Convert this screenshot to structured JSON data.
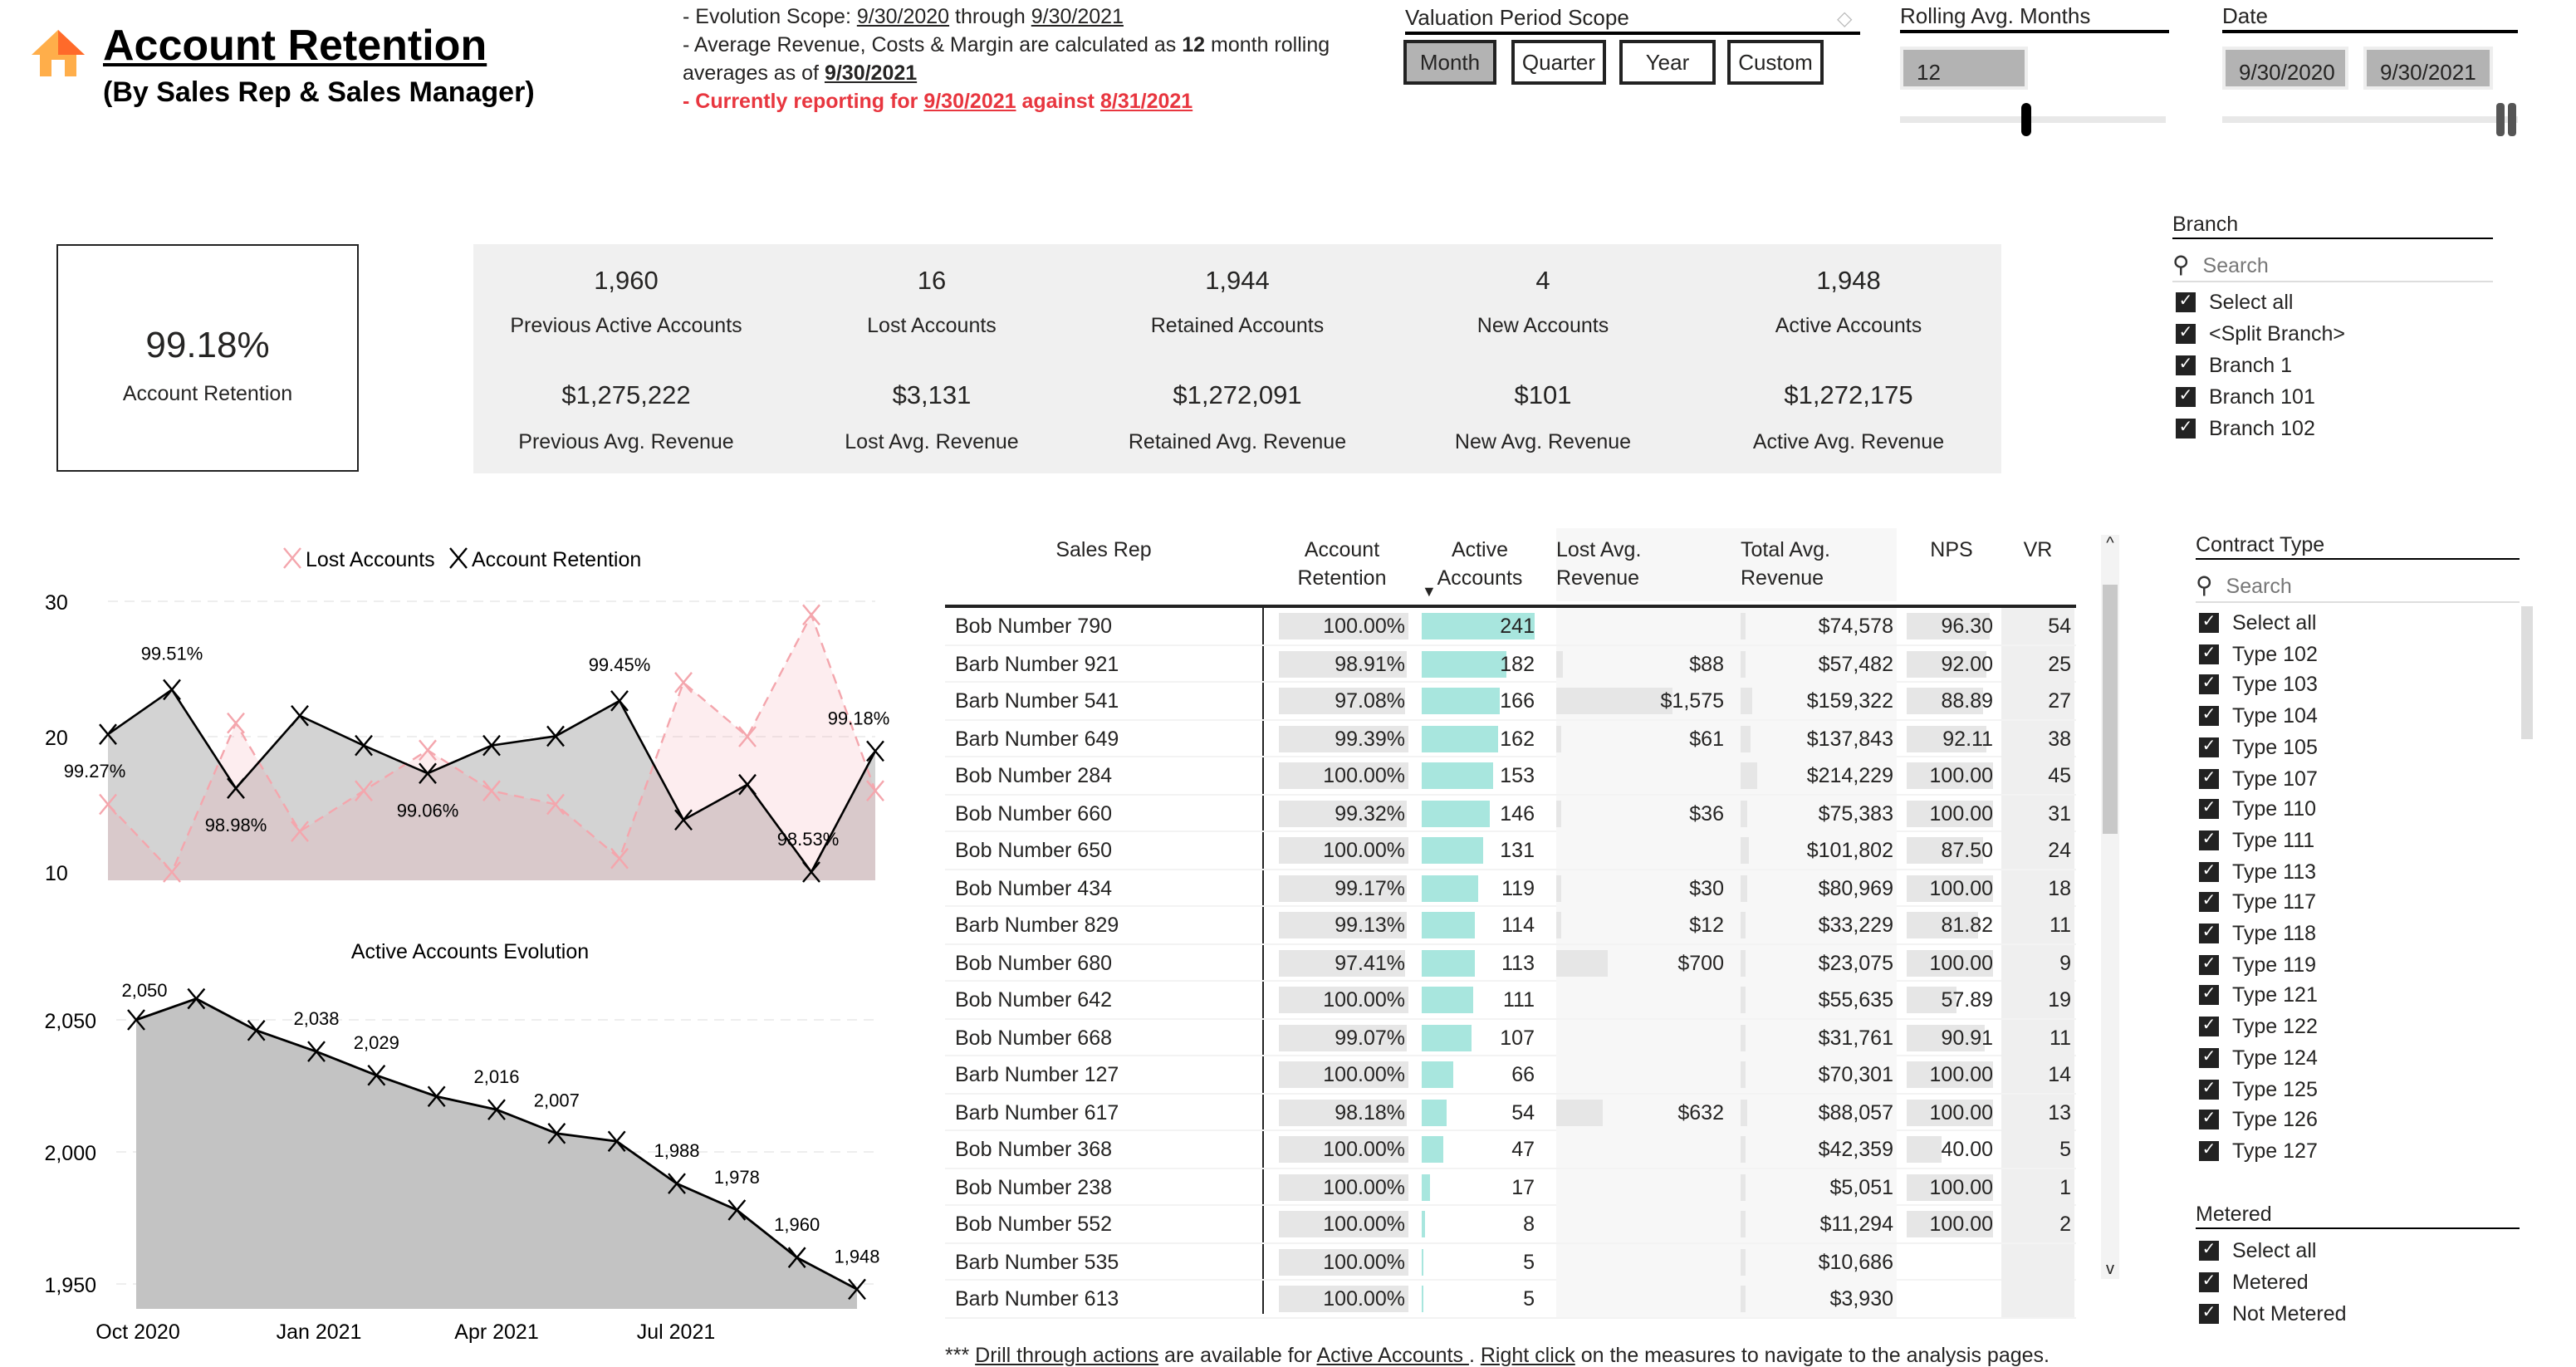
{
  "header": {
    "title": "Account Retention",
    "subtitle": "(By Sales Rep & Sales Manager)",
    "icon": "home-icon"
  },
  "notes": {
    "l1_pre": "- Evolution Scope: ",
    "l1_d1": "9/30/2020",
    "l1_mid": " through ",
    "l1_d2": "9/30/2021",
    "l2_pre": "- Average Revenue, Costs & Margin are calculated as ",
    "l2_num": "12",
    "l2_post": " month rolling averages as of ",
    "l2_date": "9/30/2021",
    "l3_pre": "- Currently reporting for ",
    "l3_d1": "9/30/2021",
    "l3_mid": " against ",
    "l3_d2": "8/31/2021"
  },
  "period": {
    "title": "Valuation Period Scope",
    "options": [
      "Month",
      "Quarter",
      "Year",
      "Custom"
    ],
    "selected": "Month",
    "eraser_icon": "eraser-icon"
  },
  "rolling": {
    "title": "Rolling Avg. Months",
    "value": "12",
    "slider_fraction": 0.5
  },
  "date": {
    "title": "Date",
    "from": "9/30/2020",
    "to": "9/30/2021",
    "slider_fraction": 1.0
  },
  "kpi_main": {
    "value": "99.18%",
    "label": "Account Retention"
  },
  "kpis": [
    {
      "v1": "1,960",
      "l1": "Previous Active Accounts",
      "v2": "$1,275,222",
      "l2": "Previous Avg. Revenue"
    },
    {
      "v1": "16",
      "l1": "Lost Accounts",
      "v2": "$3,131",
      "l2": "Lost Avg. Revenue"
    },
    {
      "v1": "1,944",
      "l1": "Retained Accounts",
      "v2": "$1,272,091",
      "l2": "Retained Avg. Revenue"
    },
    {
      "v1": "4",
      "l1": "New Accounts",
      "v2": "$101",
      "l2": "New Avg. Revenue"
    },
    {
      "v1": "1,948",
      "l1": "Active Accounts",
      "v2": "$1,272,175",
      "l2": "Active Avg. Revenue"
    }
  ],
  "branch": {
    "title": "Branch",
    "search": "Search",
    "items": [
      "Select all",
      "<Split Branch>",
      "Branch 1",
      "Branch 101",
      "Branch 102"
    ]
  },
  "contract": {
    "title": "Contract Type",
    "search": "Search",
    "items": [
      "Select all",
      "Type 102",
      "Type 103",
      "Type 104",
      "Type 105",
      "Type 107",
      "Type 110",
      "Type 111",
      "Type 113",
      "Type 117",
      "Type 118",
      "Type 119",
      "Type 121",
      "Type 122",
      "Type 124",
      "Type 125",
      "Type 126",
      "Type 127"
    ]
  },
  "metered": {
    "title": "Metered",
    "items": [
      "Select all",
      "Metered",
      "Not Metered"
    ]
  },
  "table": {
    "headers": [
      "Sales Rep",
      "Account\nRetention",
      "Active\nAccounts",
      "Lost Avg.\nRevenue",
      "Total Avg.\nRevenue",
      "NPS",
      "VR"
    ],
    "sort_column": "Active Accounts",
    "sort_dir": "desc",
    "bar_color": "#a8e6de",
    "rows": [
      [
        "Bob Number 790",
        "100.00%",
        "241",
        "",
        "$74,578",
        "96.30",
        "54"
      ],
      [
        "Barb Number 921",
        "98.91%",
        "182",
        "$88",
        "$57,482",
        "92.00",
        "25"
      ],
      [
        "Barb Number 541",
        "97.08%",
        "166",
        "$1,575",
        "$159,322",
        "88.89",
        "27"
      ],
      [
        "Barb Number 649",
        "99.39%",
        "162",
        "$61",
        "$137,843",
        "92.11",
        "38"
      ],
      [
        "Bob Number 284",
        "100.00%",
        "153",
        "",
        "$214,229",
        "100.00",
        "45"
      ],
      [
        "Bob Number 660",
        "99.32%",
        "146",
        "$36",
        "$75,383",
        "100.00",
        "31"
      ],
      [
        "Bob Number 650",
        "100.00%",
        "131",
        "",
        "$101,802",
        "87.50",
        "24"
      ],
      [
        "Bob Number 434",
        "99.17%",
        "119",
        "$30",
        "$80,969",
        "100.00",
        "18"
      ],
      [
        "Barb Number 829",
        "99.13%",
        "114",
        "$12",
        "$33,229",
        "81.82",
        "11"
      ],
      [
        "Bob Number 680",
        "97.41%",
        "113",
        "$700",
        "$23,075",
        "100.00",
        "9"
      ],
      [
        "Bob Number 642",
        "100.00%",
        "111",
        "",
        "$55,635",
        "57.89",
        "19"
      ],
      [
        "Bob Number 668",
        "99.07%",
        "107",
        "",
        "$31,761",
        "90.91",
        "11"
      ],
      [
        "Barb Number 127",
        "100.00%",
        "66",
        "",
        "$70,301",
        "100.00",
        "14"
      ],
      [
        "Barb Number 617",
        "98.18%",
        "54",
        "$632",
        "$88,057",
        "100.00",
        "13"
      ],
      [
        "Bob Number 368",
        "100.00%",
        "47",
        "",
        "$42,359",
        "40.00",
        "5"
      ],
      [
        "Bob Number 238",
        "100.00%",
        "17",
        "",
        "$5,051",
        "100.00",
        "1"
      ],
      [
        "Bob Number 552",
        "100.00%",
        "8",
        "",
        "$11,294",
        "100.00",
        "2"
      ],
      [
        "Barb Number 535",
        "100.00%",
        "5",
        "",
        "$10,686",
        "",
        ""
      ],
      [
        "Barb Number 613",
        "100.00%",
        "5",
        "",
        "$3,930",
        "",
        ""
      ]
    ]
  },
  "footer": {
    "pre": "*** ",
    "l1": "Drill through actions",
    "m1": " are available for ",
    "l2": "Active Accounts ",
    "m2": ". ",
    "l3": "Right click",
    "post": " on the measures to navigate to the analysis pages."
  },
  "chart_data": [
    {
      "type": "line",
      "legend_position": "top-center",
      "grid": true,
      "yticks": [
        "30",
        "20",
        "10"
      ],
      "ylim": [
        10,
        30
      ],
      "y2lim": [
        98.53,
        99.985
      ],
      "series": [
        {
          "name": "Lost Accounts",
          "color": "#f4a6ad",
          "style": "dashed-area",
          "values": [
            15,
            10,
            21,
            13,
            16,
            19,
            16,
            15,
            11,
            24,
            20,
            29,
            16
          ]
        },
        {
          "name": "Account Retention",
          "color": "#000000",
          "style": "solid-area",
          "axis": "secondary",
          "values": [
            99.27,
            99.51,
            98.98,
            99.37,
            99.21,
            99.06,
            99.21,
            99.26,
            99.45,
            98.81,
            99.0,
            98.53,
            99.18
          ],
          "labels": [
            "99.27%",
            "99.51%",
            "98.98%",
            "",
            "",
            "99.06%",
            "",
            "",
            "99.45%",
            "",
            "",
            "98.53%",
            "99.18%"
          ]
        }
      ]
    },
    {
      "type": "area",
      "title": "Active Accounts Evolution",
      "ylim": [
        1937,
        2070
      ],
      "grid": true,
      "yticks": [
        "2,050",
        "2,000",
        "1,950"
      ],
      "ytick_values": [
        2050,
        2000,
        1950
      ],
      "xticks": [
        "Oct 2020",
        "Jan 2021",
        "Apr 2021",
        "Jul 2021"
      ],
      "values": [
        2050,
        2058,
        2046,
        2038,
        2029,
        2021,
        2016,
        2007,
        2004,
        1988,
        1978,
        1960,
        1948
      ],
      "labels": [
        "2,050",
        "",
        "",
        "2,038",
        "2,029",
        "",
        "2,016",
        "2,007",
        "",
        "1,988",
        "1,978",
        "1,960",
        "1,948"
      ]
    }
  ]
}
